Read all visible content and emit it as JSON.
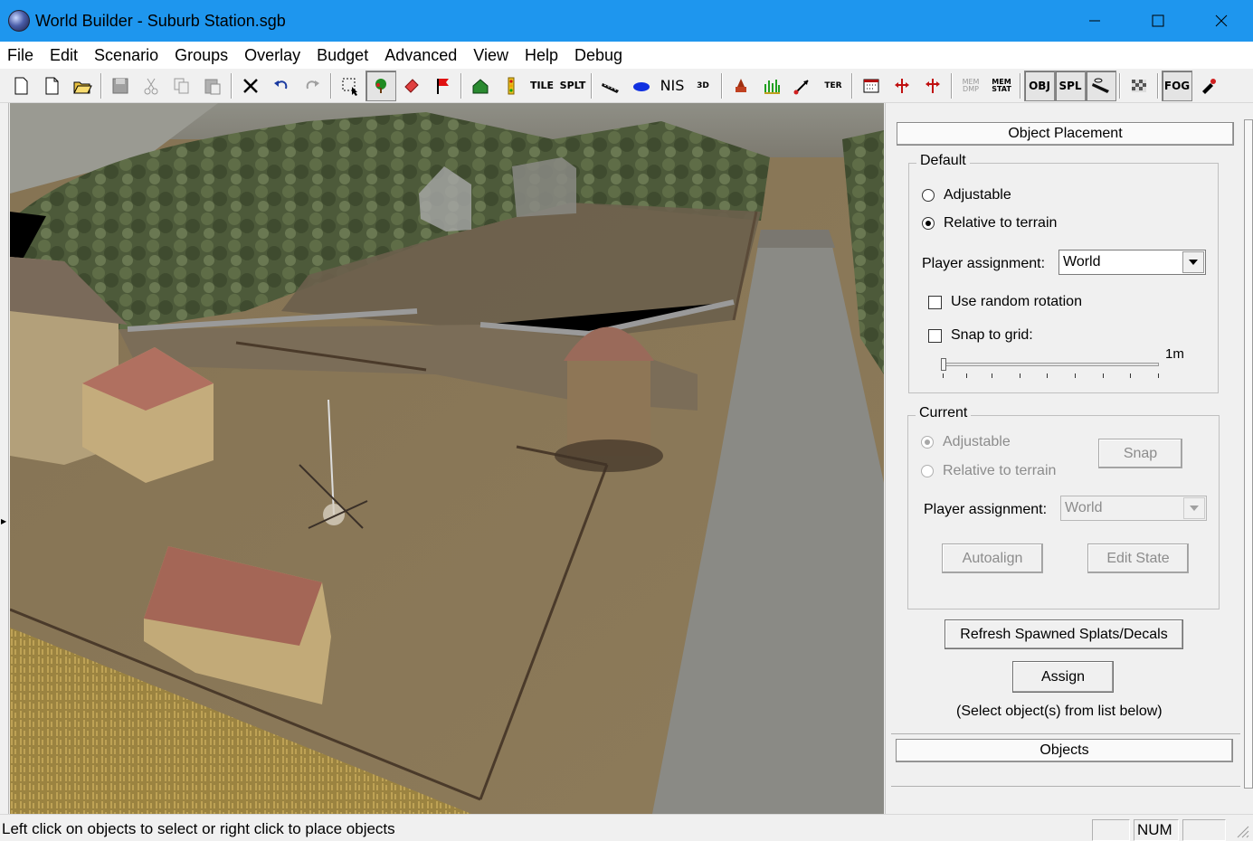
{
  "window": {
    "title": "World Builder - Suburb Station.sgb"
  },
  "menu": [
    "File",
    "Edit",
    "Scenario",
    "Groups",
    "Overlay",
    "Budget",
    "Advanced",
    "View",
    "Help",
    "Debug"
  ],
  "toolbar": {
    "text_buttons": {
      "tile": "TILE",
      "splt": "SPLT",
      "nis": "NIS",
      "three_d": "3D",
      "ter": "TER",
      "mem_dmp": "MEM DMP",
      "mem_stat": "MEM STAT",
      "obj": "OBJ",
      "spl": "SPL",
      "fog": "FOG"
    }
  },
  "panel": {
    "object_placement_label": "Object Placement",
    "default_group": {
      "title": "Default",
      "adjustable_label": "Adjustable",
      "relative_label": "Relative to terrain",
      "selected": "Relative to terrain",
      "player_assignment_label": "Player assignment:",
      "player_assignment_value": "World",
      "random_rotation_label": "Use random rotation",
      "random_rotation_checked": false,
      "snap_to_grid_label": "Snap to grid:",
      "snap_to_grid_checked": false,
      "grid_value": "1m"
    },
    "current_group": {
      "title": "Current",
      "adjustable_label": "Adjustable",
      "relative_label": "Relative to terrain",
      "snap_label": "Snap",
      "player_assignment_label": "Player assignment:",
      "player_assignment_value": "World",
      "autoalign_label": "Autoalign",
      "edit_state_label": "Edit State"
    },
    "refresh_label": "Refresh Spawned Splats/Decals",
    "assign_label": "Assign",
    "hint_text": "(Select object(s) from list below)",
    "objects_label": "Objects"
  },
  "status": {
    "message": "Left click on objects to select or right click to place objects",
    "num_indicator": "NUM"
  },
  "colors": {
    "titlebar": "#1e96ee",
    "panel_bg": "#f0f0f0"
  }
}
